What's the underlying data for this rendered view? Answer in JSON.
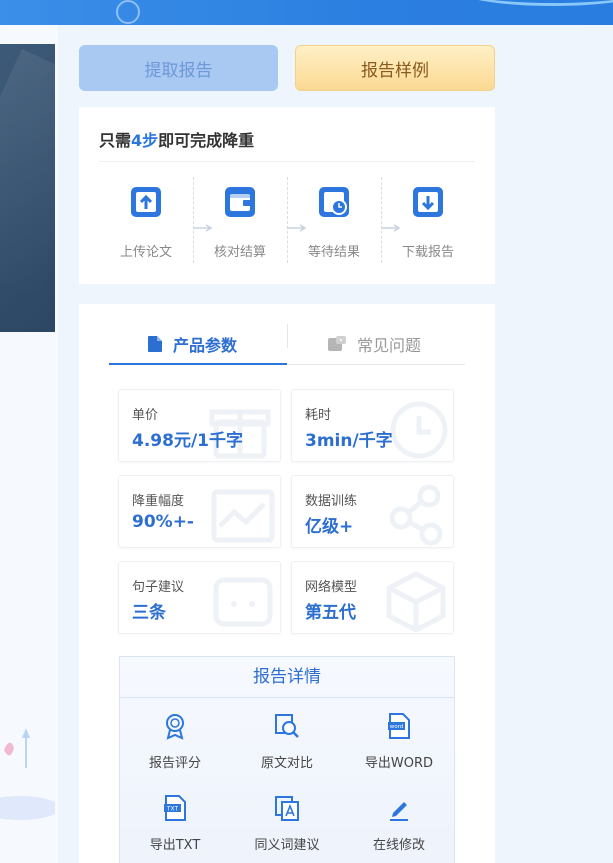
{
  "buttons": {
    "extract": "提取报告",
    "sample": "报告样例"
  },
  "steps": {
    "title_prefix": "只需",
    "title_highlight": "4步",
    "title_suffix": "即可完成降重",
    "items": [
      {
        "label": "上传论文",
        "icon": "upload-icon"
      },
      {
        "label": "核对结算",
        "icon": "wallet-icon"
      },
      {
        "label": "等待结果",
        "icon": "clock-icon"
      },
      {
        "label": "下载报告",
        "icon": "download-icon"
      }
    ]
  },
  "tabs": {
    "params": "产品参数",
    "faq": "常见问题"
  },
  "params": [
    {
      "key": "单价",
      "value": "4.98元/1千字"
    },
    {
      "key": "耗时",
      "value": "3min/千字"
    },
    {
      "key": "降重幅度",
      "value": "90%+-"
    },
    {
      "key": "数据训练",
      "value": "亿级+"
    },
    {
      "key": "句子建议",
      "value": "三条"
    },
    {
      "key": "网络模型",
      "value": "第五代"
    }
  ],
  "details": {
    "title": "报告详情",
    "items": [
      {
        "label": "报告评分",
        "icon": "medal-icon"
      },
      {
        "label": "原文对比",
        "icon": "compare-search-icon"
      },
      {
        "label": "导出WORD",
        "icon": "word-file-icon"
      },
      {
        "label": "导出TXT",
        "icon": "txt-file-icon"
      },
      {
        "label": "同义词建议",
        "icon": "synonym-icon"
      },
      {
        "label": "在线修改",
        "icon": "pen-icon"
      }
    ]
  },
  "colors": {
    "primary": "#2d76de",
    "topbar": "#2b7fe0",
    "extract_button": "#a9c9f3",
    "sample_button": "#fcd993"
  }
}
